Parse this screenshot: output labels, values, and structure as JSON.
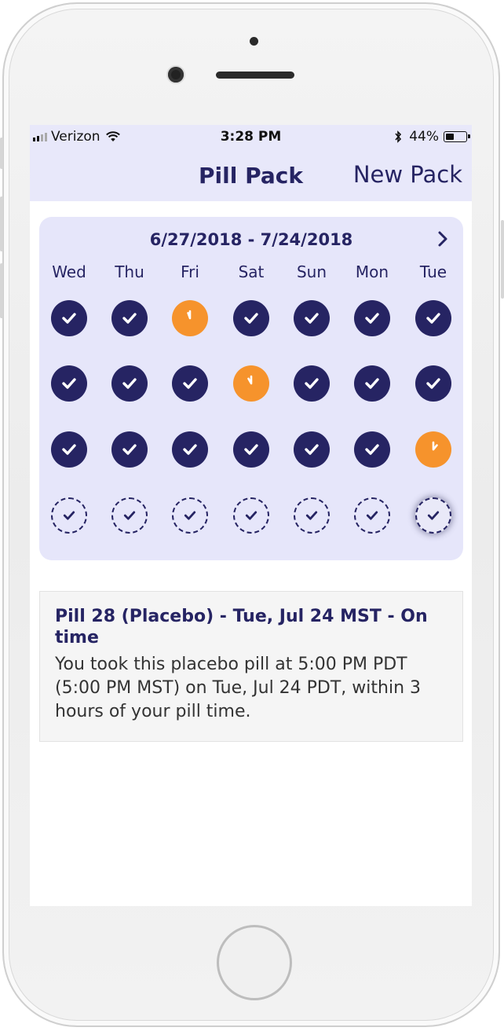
{
  "status_bar": {
    "carrier": "Verizon",
    "time": "3:28 PM",
    "battery": "44%",
    "battery_level": 0.44
  },
  "nav": {
    "title": "Pill Pack",
    "action": "New Pack"
  },
  "calendar": {
    "date_range": "6/27/2018 - 7/24/2018",
    "weekdays": [
      "Wed",
      "Thu",
      "Fri",
      "Sat",
      "Sun",
      "Mon",
      "Tue"
    ],
    "weeks": [
      [
        "taken",
        "taken",
        "late",
        "taken",
        "taken",
        "taken",
        "taken"
      ],
      [
        "taken",
        "taken",
        "taken",
        "late",
        "taken",
        "taken",
        "taken"
      ],
      [
        "taken",
        "taken",
        "taken",
        "taken",
        "taken",
        "taken",
        "late"
      ],
      [
        "placebo",
        "placebo",
        "placebo",
        "placebo",
        "placebo",
        "placebo",
        "placebo-selected"
      ]
    ],
    "colors": {
      "taken": "#262463",
      "late": "#f6932c",
      "background": "#e6e6fa"
    }
  },
  "detail": {
    "title": "Pill 28 (Placebo) - Tue, Jul 24 MST - On time",
    "body": "You took this placebo pill at 5:00 PM PDT (5:00 PM MST) on Tue, Jul 24 PDT, within 3 hours of your pill time."
  }
}
